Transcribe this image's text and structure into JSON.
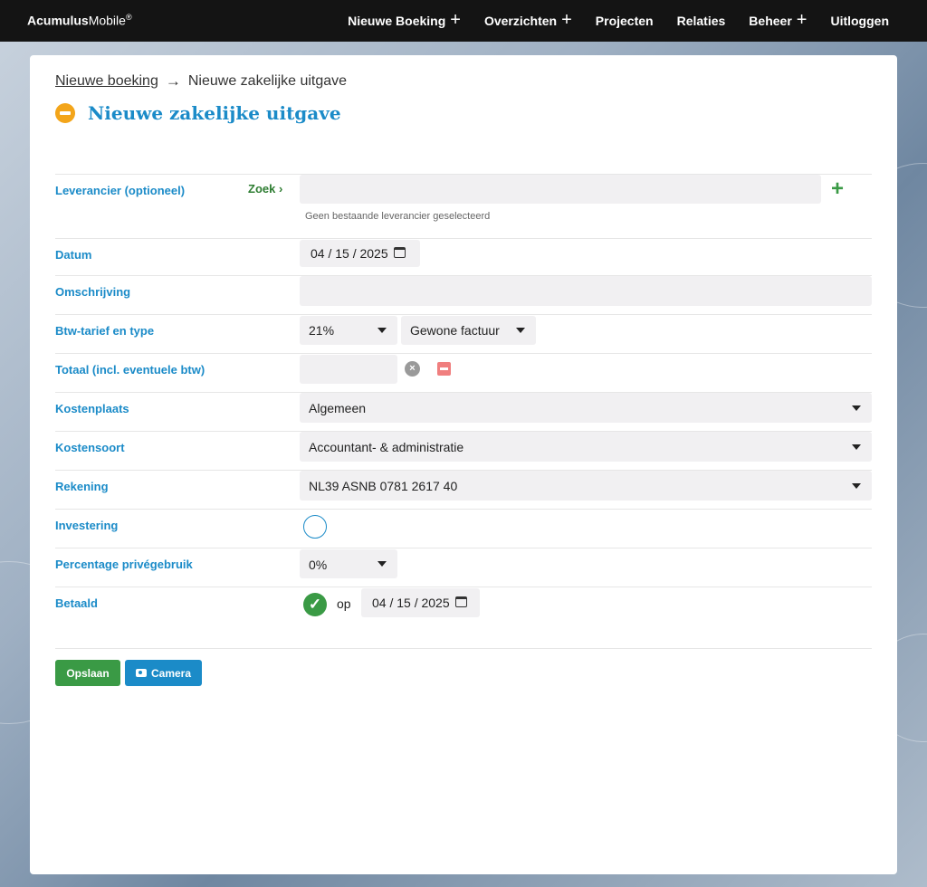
{
  "brand": {
    "bold": "Acumulus",
    "normal": "Mobile",
    "mark": "®"
  },
  "nav": {
    "items": [
      {
        "label": "Nieuwe Boeking",
        "expand": "+"
      },
      {
        "label": "Overzichten",
        "expand": "+"
      },
      {
        "label": "Projecten"
      },
      {
        "label": "Relaties"
      },
      {
        "label": "Beheer",
        "expand": "+"
      },
      {
        "label": "Uitloggen"
      }
    ]
  },
  "breadcrumb": {
    "parent": "Nieuwe boeking",
    "arrow": "→",
    "current": "Nieuwe zakelijke uitgave"
  },
  "page_title": "Nieuwe zakelijke uitgave",
  "form": {
    "leverancier": {
      "label": "Leverancier (optioneel)",
      "zoek": "Zoek",
      "zoek_arrow": "›",
      "value": "",
      "add": "+",
      "hint": "Geen bestaande leverancier geselecteerd"
    },
    "datum": {
      "label": "Datum",
      "value": "04 / 15 / 2025"
    },
    "omschrijving": {
      "label": "Omschrijving",
      "value": ""
    },
    "btw": {
      "label": "Btw-tarief en type",
      "tarief": "21%",
      "type": "Gewone factuur"
    },
    "totaal": {
      "label": "Totaal (incl. eventuele btw)",
      "value": "",
      "clear": "×"
    },
    "kostenplaats": {
      "label": "Kostenplaats",
      "value": "Algemeen"
    },
    "kostensoort": {
      "label": "Kostensoort",
      "value": "Accountant- & administratie"
    },
    "rekening": {
      "label": "Rekening",
      "value": "NL39 ASNB 0781 2617 40"
    },
    "investering": {
      "label": "Investering",
      "checked": false
    },
    "prive": {
      "label": "Percentage privégebruik",
      "value": "0%"
    },
    "betaald": {
      "label": "Betaald",
      "checked": true,
      "check": "✓",
      "op": "op",
      "date": "04 / 15 / 2025"
    }
  },
  "buttons": {
    "save": "Opslaan",
    "camera": "Camera"
  },
  "colors": {
    "accent": "#1b8bc8",
    "success": "#3a9a45",
    "warning": "#f3a51a",
    "danger": "#f07f7f"
  }
}
